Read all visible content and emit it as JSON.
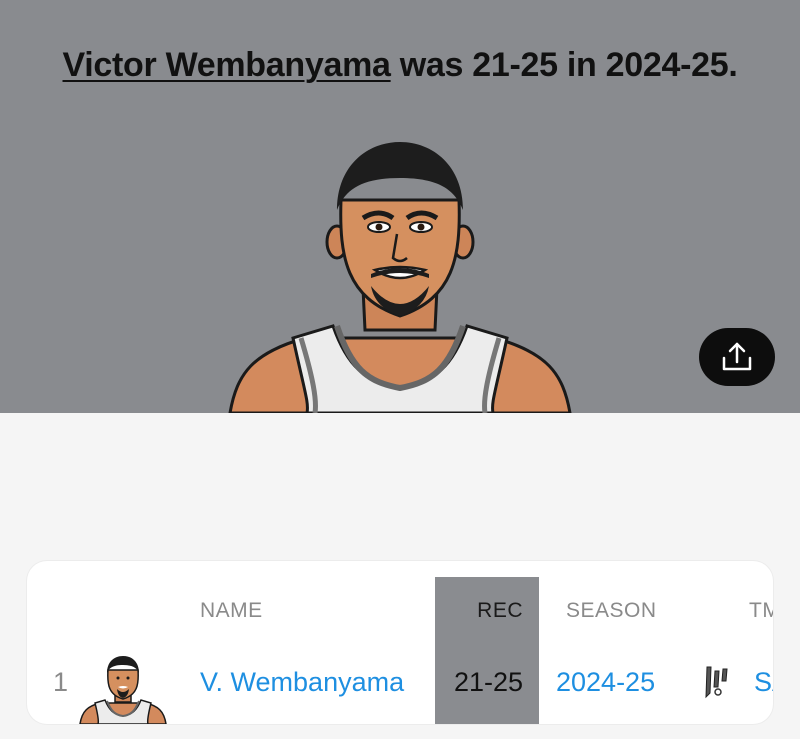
{
  "headline": {
    "player": "Victor Wembanyama",
    "rest": " was 21-25 in 2024-25."
  },
  "table": {
    "headers": {
      "name": "NAME",
      "rec": "REC",
      "season": "SEASON",
      "tm": "TM"
    },
    "rows": [
      {
        "rank": "1",
        "name": "V. Wembanyama",
        "rec": "21-25",
        "season": "2024-25",
        "team_abbr": "SAS",
        "team_logo_icon": "spurs-logo-icon"
      }
    ]
  },
  "icons": {
    "share": "share-upload-icon"
  },
  "colors": {
    "hero_bg": "#898b8f",
    "highlight_column": "#8a8c90",
    "link_blue": "#1e8fe1",
    "share_button_bg": "#0d0d0d"
  }
}
